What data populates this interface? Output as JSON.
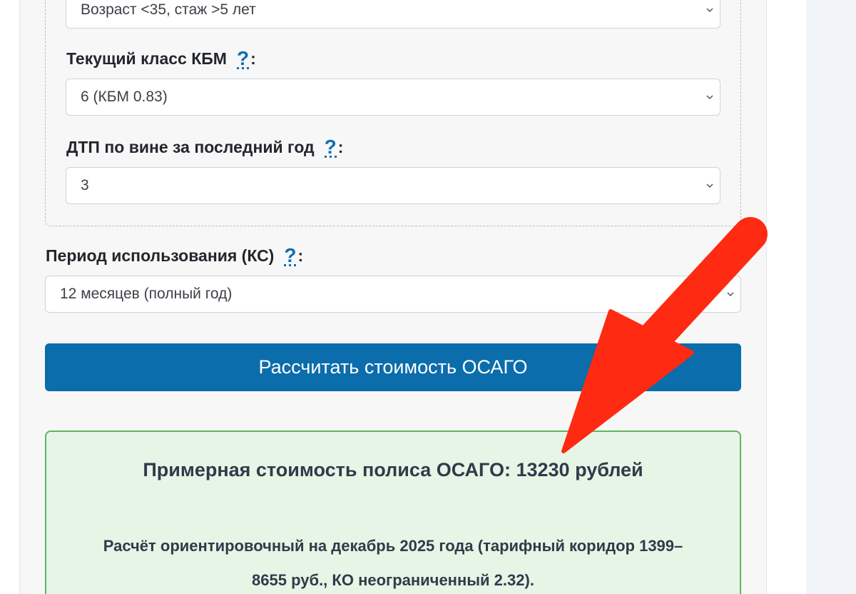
{
  "form": {
    "age_experience": {
      "value": "Возраст <35, стаж >5 лет"
    },
    "kbm": {
      "label": "Текущий класс КБМ",
      "help": "?",
      "colon": ":",
      "value": "6 (КБМ 0.83)"
    },
    "accidents": {
      "label": "ДТП по вине за последний год",
      "help": "?",
      "colon": ":",
      "value": "3"
    },
    "period": {
      "label": "Период использования (КС)",
      "help": "?",
      "colon": ":",
      "value": "12 месяцев (полный год)"
    },
    "calculate_button": "Рассчитать стоимость ОСАГО"
  },
  "result": {
    "title": "Примерная стоимость полиса ОСАГО: 13230 рублей",
    "note_line1": "Расчёт ориентировочный на декабрь 2025 года (тарифный коридор 1399–",
    "note_line2": "8655 руб., КО неограниченный 2.32)."
  },
  "colors": {
    "button": "#0b6dab",
    "help_icon": "#0f6fb0",
    "result_border": "#5cb85c",
    "result_bg": "#e7f5e6",
    "annotation_arrow": "#ff2a12"
  },
  "icons": {
    "select_chevron": "chevron-down-icon",
    "help": "help-question-icon",
    "annotation": "red-arrow-annotation"
  }
}
